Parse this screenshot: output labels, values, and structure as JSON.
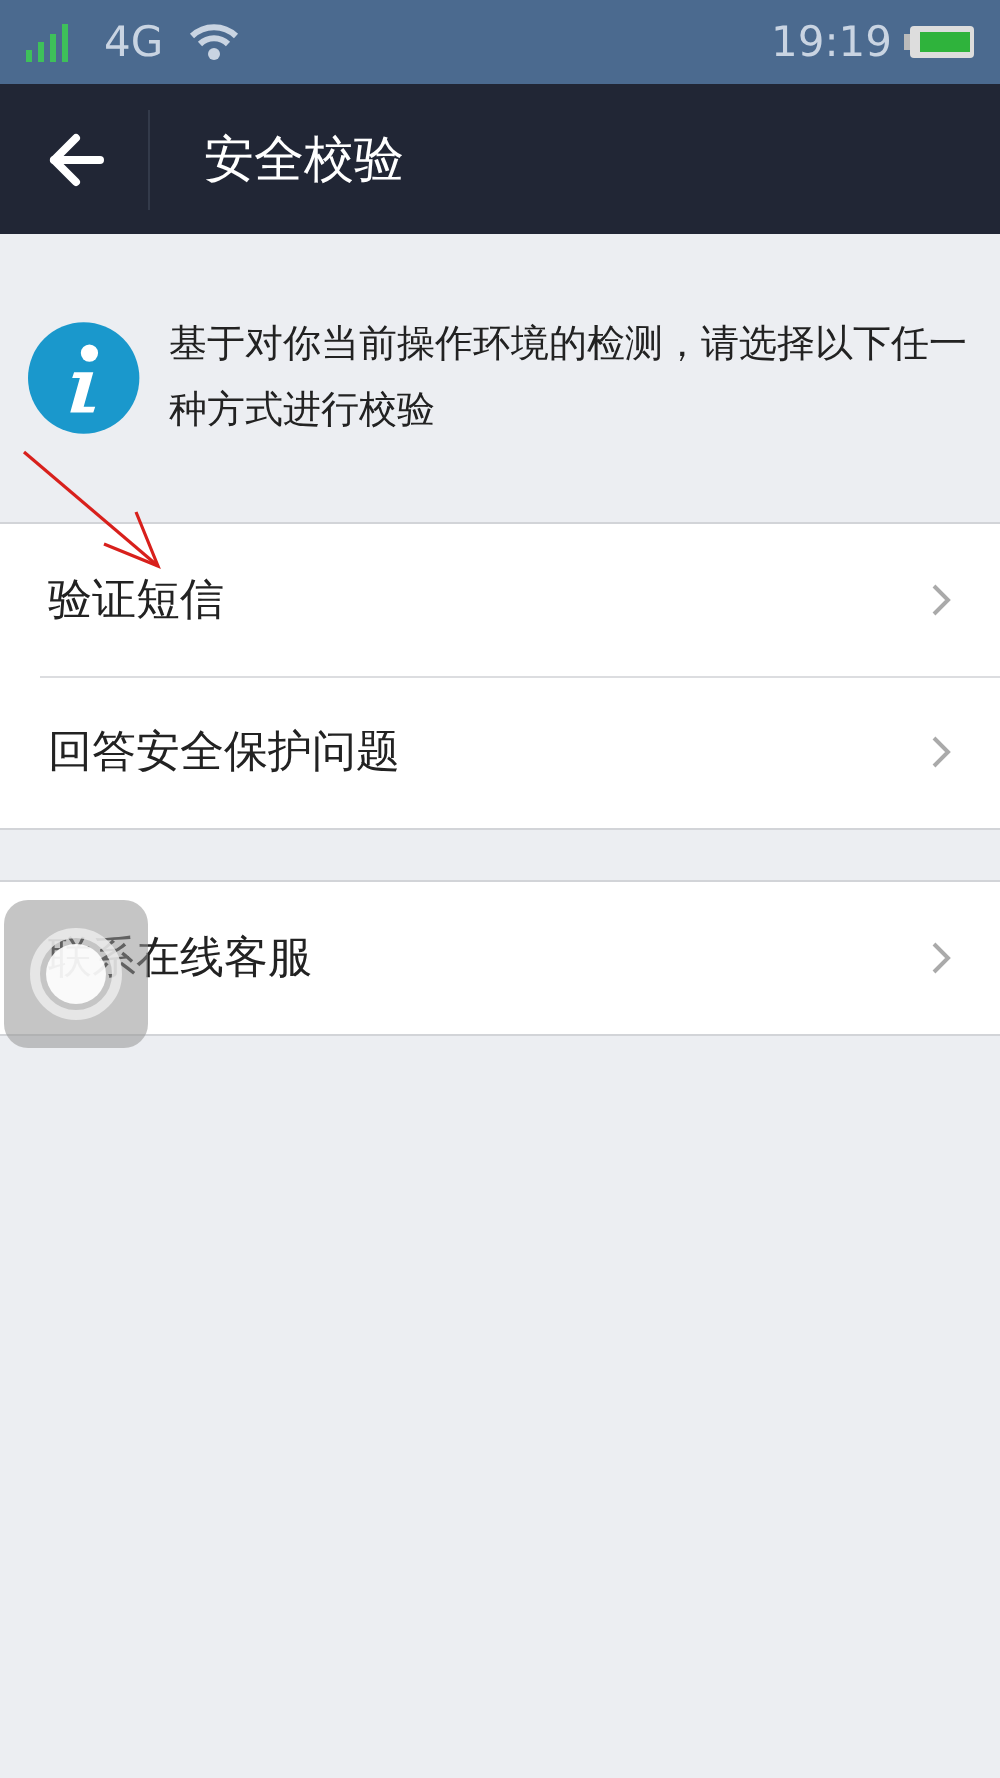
{
  "status_bar": {
    "network": "4G",
    "time": "19:19"
  },
  "header": {
    "title": "安全校验"
  },
  "notice": {
    "text": "基于对你当前操作环境的检测，请选择以下任一种方式进行校验"
  },
  "groups": [
    {
      "items": [
        {
          "label": "验证短信"
        },
        {
          "label": "回答安全保护问题"
        }
      ]
    },
    {
      "items": [
        {
          "label": "联系在线客服"
        }
      ]
    }
  ]
}
